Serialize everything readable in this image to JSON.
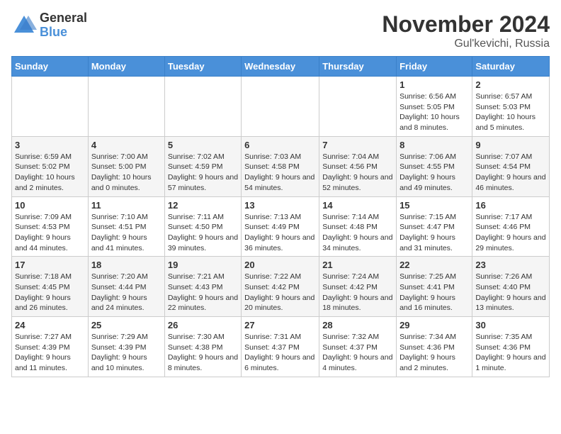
{
  "logo": {
    "general": "General",
    "blue": "Blue"
  },
  "title": "November 2024",
  "subtitle": "Gul'kevichi, Russia",
  "weekdays": [
    "Sunday",
    "Monday",
    "Tuesday",
    "Wednesday",
    "Thursday",
    "Friday",
    "Saturday"
  ],
  "weeks": [
    [
      {
        "day": "",
        "info": ""
      },
      {
        "day": "",
        "info": ""
      },
      {
        "day": "",
        "info": ""
      },
      {
        "day": "",
        "info": ""
      },
      {
        "day": "",
        "info": ""
      },
      {
        "day": "1",
        "info": "Sunrise: 6:56 AM\nSunset: 5:05 PM\nDaylight: 10 hours and 8 minutes."
      },
      {
        "day": "2",
        "info": "Sunrise: 6:57 AM\nSunset: 5:03 PM\nDaylight: 10 hours and 5 minutes."
      }
    ],
    [
      {
        "day": "3",
        "info": "Sunrise: 6:59 AM\nSunset: 5:02 PM\nDaylight: 10 hours and 2 minutes."
      },
      {
        "day": "4",
        "info": "Sunrise: 7:00 AM\nSunset: 5:00 PM\nDaylight: 10 hours and 0 minutes."
      },
      {
        "day": "5",
        "info": "Sunrise: 7:02 AM\nSunset: 4:59 PM\nDaylight: 9 hours and 57 minutes."
      },
      {
        "day": "6",
        "info": "Sunrise: 7:03 AM\nSunset: 4:58 PM\nDaylight: 9 hours and 54 minutes."
      },
      {
        "day": "7",
        "info": "Sunrise: 7:04 AM\nSunset: 4:56 PM\nDaylight: 9 hours and 52 minutes."
      },
      {
        "day": "8",
        "info": "Sunrise: 7:06 AM\nSunset: 4:55 PM\nDaylight: 9 hours and 49 minutes."
      },
      {
        "day": "9",
        "info": "Sunrise: 7:07 AM\nSunset: 4:54 PM\nDaylight: 9 hours and 46 minutes."
      }
    ],
    [
      {
        "day": "10",
        "info": "Sunrise: 7:09 AM\nSunset: 4:53 PM\nDaylight: 9 hours and 44 minutes."
      },
      {
        "day": "11",
        "info": "Sunrise: 7:10 AM\nSunset: 4:51 PM\nDaylight: 9 hours and 41 minutes."
      },
      {
        "day": "12",
        "info": "Sunrise: 7:11 AM\nSunset: 4:50 PM\nDaylight: 9 hours and 39 minutes."
      },
      {
        "day": "13",
        "info": "Sunrise: 7:13 AM\nSunset: 4:49 PM\nDaylight: 9 hours and 36 minutes."
      },
      {
        "day": "14",
        "info": "Sunrise: 7:14 AM\nSunset: 4:48 PM\nDaylight: 9 hours and 34 minutes."
      },
      {
        "day": "15",
        "info": "Sunrise: 7:15 AM\nSunset: 4:47 PM\nDaylight: 9 hours and 31 minutes."
      },
      {
        "day": "16",
        "info": "Sunrise: 7:17 AM\nSunset: 4:46 PM\nDaylight: 9 hours and 29 minutes."
      }
    ],
    [
      {
        "day": "17",
        "info": "Sunrise: 7:18 AM\nSunset: 4:45 PM\nDaylight: 9 hours and 26 minutes."
      },
      {
        "day": "18",
        "info": "Sunrise: 7:20 AM\nSunset: 4:44 PM\nDaylight: 9 hours and 24 minutes."
      },
      {
        "day": "19",
        "info": "Sunrise: 7:21 AM\nSunset: 4:43 PM\nDaylight: 9 hours and 22 minutes."
      },
      {
        "day": "20",
        "info": "Sunrise: 7:22 AM\nSunset: 4:42 PM\nDaylight: 9 hours and 20 minutes."
      },
      {
        "day": "21",
        "info": "Sunrise: 7:24 AM\nSunset: 4:42 PM\nDaylight: 9 hours and 18 minutes."
      },
      {
        "day": "22",
        "info": "Sunrise: 7:25 AM\nSunset: 4:41 PM\nDaylight: 9 hours and 16 minutes."
      },
      {
        "day": "23",
        "info": "Sunrise: 7:26 AM\nSunset: 4:40 PM\nDaylight: 9 hours and 13 minutes."
      }
    ],
    [
      {
        "day": "24",
        "info": "Sunrise: 7:27 AM\nSunset: 4:39 PM\nDaylight: 9 hours and 11 minutes."
      },
      {
        "day": "25",
        "info": "Sunrise: 7:29 AM\nSunset: 4:39 PM\nDaylight: 9 hours and 10 minutes."
      },
      {
        "day": "26",
        "info": "Sunrise: 7:30 AM\nSunset: 4:38 PM\nDaylight: 9 hours and 8 minutes."
      },
      {
        "day": "27",
        "info": "Sunrise: 7:31 AM\nSunset: 4:37 PM\nDaylight: 9 hours and 6 minutes."
      },
      {
        "day": "28",
        "info": "Sunrise: 7:32 AM\nSunset: 4:37 PM\nDaylight: 9 hours and 4 minutes."
      },
      {
        "day": "29",
        "info": "Sunrise: 7:34 AM\nSunset: 4:36 PM\nDaylight: 9 hours and 2 minutes."
      },
      {
        "day": "30",
        "info": "Sunrise: 7:35 AM\nSunset: 4:36 PM\nDaylight: 9 hours and 1 minute."
      }
    ]
  ]
}
